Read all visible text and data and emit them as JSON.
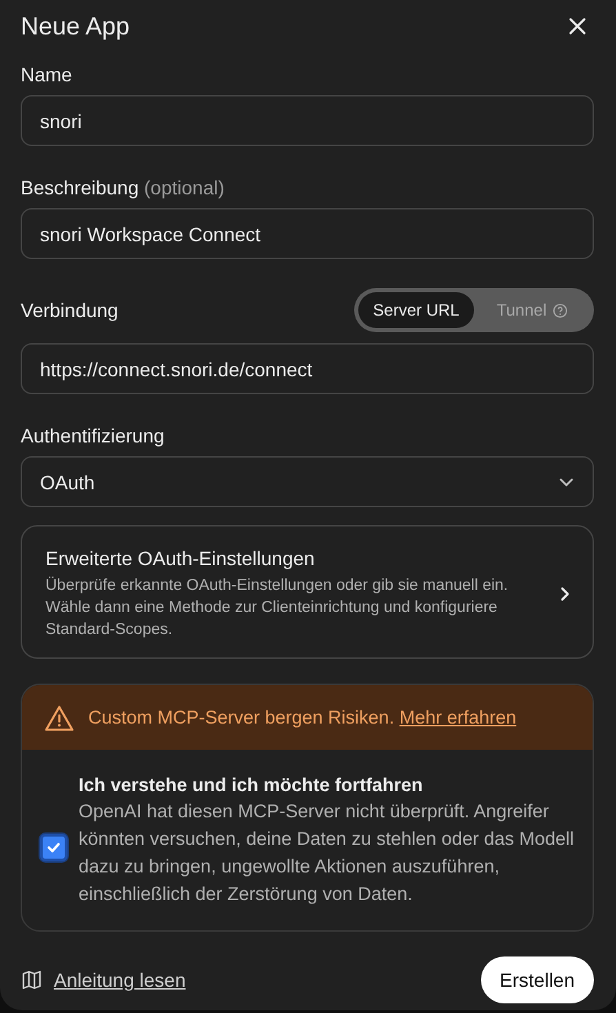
{
  "dialog": {
    "title": "Neue App"
  },
  "fields": [
    {
      "label": "Name",
      "value": "snori"
    },
    {
      "label": "Beschreibung",
      "hint": "(optional)",
      "value": "snori Workspace Connect"
    }
  ],
  "connection": {
    "label": "Verbindung",
    "options": [
      {
        "label": "Server URL",
        "selected": true,
        "help": false
      },
      {
        "label": "Tunnel",
        "selected": false,
        "help": true
      }
    ],
    "value": "https://connect.snori.de/connect"
  },
  "auth": {
    "label": "Authentifizierung",
    "value": "OAuth"
  },
  "advanced": {
    "title": "Erweiterte OAuth-Einstellungen",
    "description": "Überprüfe erkannte OAuth-Einstellungen oder gib sie manuell ein. Wähle dann eine Methode zur Clienteinrichtung und konfiguriere Standard-Scopes."
  },
  "warning": {
    "message": "Custom MCP-Server bergen Risiken.",
    "link": "Mehr erfahren"
  },
  "consent": {
    "checked": true,
    "title": "Ich verstehe und ich möchte fortfahren",
    "description": "OpenAI hat diesen MCP-Server nicht überprüft. Angreifer könnten versuchen, deine Daten zu stehlen oder das Modell dazu zu bringen, ungewollte Aktionen auszuführen, einschließlich der Zerstörung von Daten."
  },
  "footer": {
    "guide_link": "Anleitung lesen",
    "create_button": "Erstellen"
  }
}
